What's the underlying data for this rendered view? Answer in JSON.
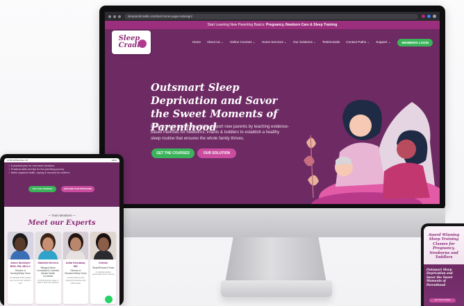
{
  "browser": {
    "url": "sleepandcradle.com/test-home-page-redesign/"
  },
  "announcement": {
    "prefix": "Start Learning New Parenting Basics:",
    "highlight": "Pregnancy, Newborn Care & Sleep Training"
  },
  "logo": {
    "line1": "Sleep",
    "line2": "Cradle"
  },
  "nav": {
    "items": [
      "Home",
      "About Us ⌄",
      "Online Courses ⌄",
      "Home Services ⌄",
      "Our Solutions ⌄",
      "Testimonials",
      "Contact Paths ⌄",
      "Support ⌄"
    ],
    "member_button": "MEMBERS LOGIN"
  },
  "hero": {
    "title": "Outsmart Sleep Deprivation and Savor the Sweet Moments of Parenthood",
    "subtitle": "Parents need quality sleep! We support new parents by teaching evidence-based methods for newborns, infants & toddlers to establish a healthy sleep routine that ensures the whole family thrives.",
    "cta_primary": "GET THE COURSES",
    "cta_secondary": "OUR SOLUTION"
  },
  "tablet": {
    "status_left": "11:55 AM  Wed Dec 18",
    "status_right": "100%",
    "bullets": [
      "✓ A practical plan for real-world situations",
      "✓ Practical skills and tips for the parenting journey",
      "✓ Better physical health, coping & recovery for mothers"
    ],
    "btn_primary": "GET THE COURSES",
    "btn_secondary": "EXPLORE OUR PROGRAMS",
    "team_label": "— Team Members —",
    "team_title": "Meet our Experts",
    "experts": [
      {
        "name": "Jeann McAlister BSN, RN, IBCLC",
        "role": "Director of Nursing/Sleep Team",
        "desc": "As Medical & RN guides new moms and newborn care",
        "skin": "#5a3a2a",
        "shirt": "#3a6fb5",
        "bg": "#d6d4e0"
      },
      {
        "name": "Gabriela Herrera",
        "role": "Bilingual Sleep Consultant & Licensed Mental Health Counselor",
        "desc": "A thriving family sleep is built to help new parents",
        "skin": "#c89072",
        "shirt": "#2fa3c9",
        "bg": "#e2dde0"
      },
      {
        "name": "Adila Khodawa, MD",
        "role": "Director of Research/Sleep Team",
        "desc": "A world-class doctor supporting families with infant sleep",
        "skin": "#b9876c",
        "shirt": "#e7e2df",
        "bg": "#d4cdd4"
      },
      {
        "name": "Chelsie",
        "role": "Sleep/Research Team",
        "desc": "A medical student passionate about science",
        "skin": "#8b5e48",
        "shirt": "#2a2a2f",
        "bg": "#e0d6d0"
      }
    ]
  },
  "phone": {
    "title": "Award Winning Sleep Training Classes for Pregnancy, Newborns and Toddlers",
    "hero": "Outsmart Sleep Deprivation and Savor the Sweet Moments of Parenthood",
    "button": "GET THE COURSES"
  },
  "colors": {
    "brand_purple": "#6d2a63",
    "accent_pink": "#c94c9e",
    "cta_green": "#3bb35a"
  }
}
